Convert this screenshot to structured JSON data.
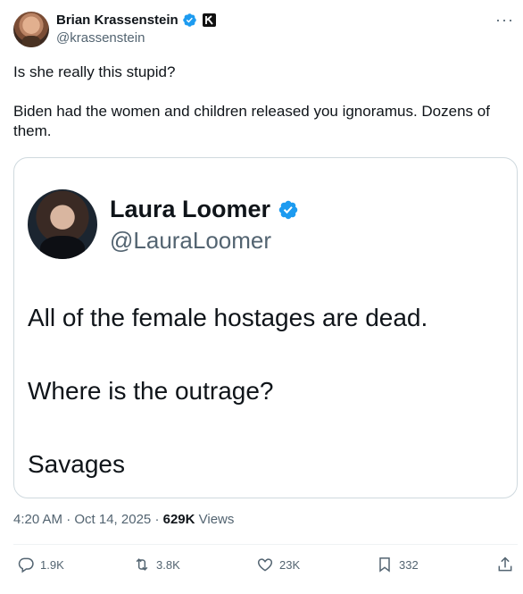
{
  "author": {
    "name": "Brian Krassenstein",
    "handle": "@krassenstein",
    "avatar_icon": "profile-photo",
    "verified_color": "#1d9bf0",
    "affiliation_icon": "k-badge-icon"
  },
  "menu_icon": "more-icon",
  "tweet": {
    "line1": "Is she really this stupid?",
    "line2": "Biden had the women and children released you ignoramus. Dozens of them."
  },
  "embedded": {
    "name": "Laura Loomer",
    "handle": "@LauraLoomer",
    "lines": [
      "All of the female hostages are dead.",
      "Where is the outrage?",
      "Savages"
    ]
  },
  "meta": {
    "timestamp": "4:20 AM · Oct 14, 2025",
    "separator": "·",
    "views_count": "629K",
    "views_label": "Views"
  },
  "actions": {
    "replies": "1.9K",
    "reposts": "3.8K",
    "likes": "23K",
    "bookmarks": "332"
  },
  "colors": {
    "text": "#0f1419",
    "secondary": "#536471",
    "border": "#cfd9de",
    "accent": "#1d9bf0"
  }
}
